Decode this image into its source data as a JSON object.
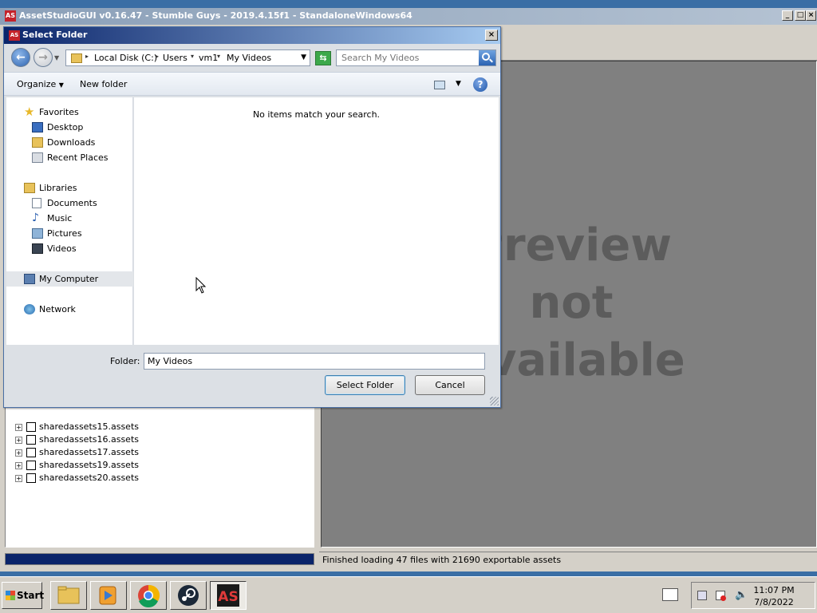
{
  "app": {
    "title": "AssetStudioGUI v0.16.47 - Stumble Guys - 2019.4.15f1 - StandaloneWindows64",
    "icon_text": "AS",
    "preview_lines": [
      "Preview",
      "not",
      "available"
    ],
    "status": "Finished loading 47 files with 21690 exportable assets",
    "progress": 1.0,
    "asset_rows": [
      "sharedassets15.assets",
      "sharedassets16.assets",
      "sharedassets17.assets",
      "sharedassets19.assets",
      "sharedassets20.assets"
    ]
  },
  "dialog": {
    "title": "Select Folder",
    "icon_text": "AS",
    "breadcrumb": [
      "Local Disk (C:)",
      "Users",
      "vm1",
      "My Videos"
    ],
    "search_placeholder": "Search My Videos",
    "toolbar": {
      "organize": "Organize",
      "new_folder": "New folder"
    },
    "nav_groups": {
      "favorites": {
        "label": "Favorites",
        "items": [
          "Desktop",
          "Downloads",
          "Recent Places"
        ]
      },
      "libraries": {
        "label": "Libraries",
        "items": [
          "Documents",
          "Music",
          "Pictures",
          "Videos"
        ]
      },
      "computer": "My Computer",
      "network": "Network"
    },
    "empty_message": "No items match your search.",
    "folder_label": "Folder:",
    "folder_value": "My Videos",
    "select_button": "Select Folder",
    "cancel_button": "Cancel"
  },
  "taskbar": {
    "start_label": "Start",
    "clock_time": "11:07 PM",
    "clock_date": "7/8/2022"
  },
  "colors": {
    "dialog_title_start": "#0a246a",
    "progress_fill": "#0a246a",
    "preview_bg": "#808080"
  }
}
